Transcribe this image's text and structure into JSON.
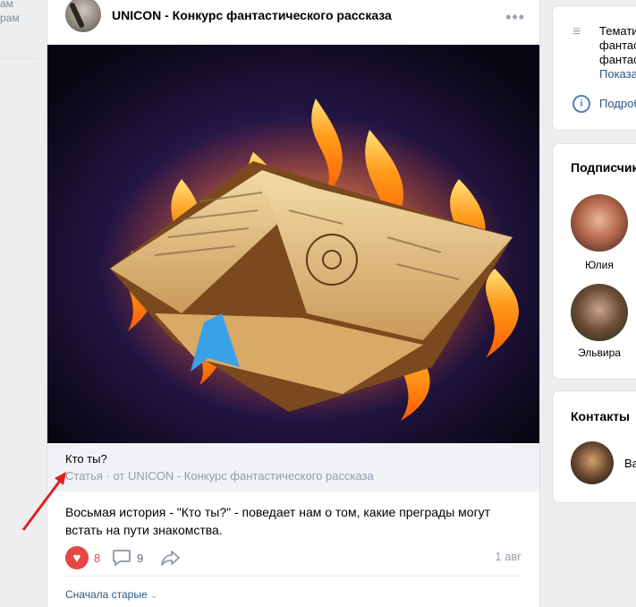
{
  "left_menu": [
    "ам",
    "рам"
  ],
  "post": {
    "group_name": "UNICON - Конкурс фантастического рассказа",
    "more_label": "•••",
    "article_title": "Кто ты?",
    "article_subtitle": "Статья · от UNICON - Конкурс фантастического рассказа",
    "text": "Восьмая история - \"Кто ты?\" - поведает нам о том, какие преграды могут встать на пути знакомства.",
    "likes": "8",
    "comments": "9",
    "date": "1 авг",
    "sort_label": "Сначала старые"
  },
  "info_card": {
    "topic_lines": [
      "Темати",
      "фантаст",
      "фантаст"
    ],
    "show_more": "Показа",
    "details": "Подроб"
  },
  "followers": {
    "title": "Подписчик",
    "people": [
      {
        "name": "Юлия"
      },
      {
        "name": "Эльвира"
      }
    ]
  },
  "contacts": {
    "title": "Контакты",
    "people": [
      {
        "name": "Ва"
      }
    ]
  },
  "colors": {
    "like": "#e64646",
    "link": "#2a5885",
    "muted": "#99a2ad",
    "background": "#edeef0"
  }
}
